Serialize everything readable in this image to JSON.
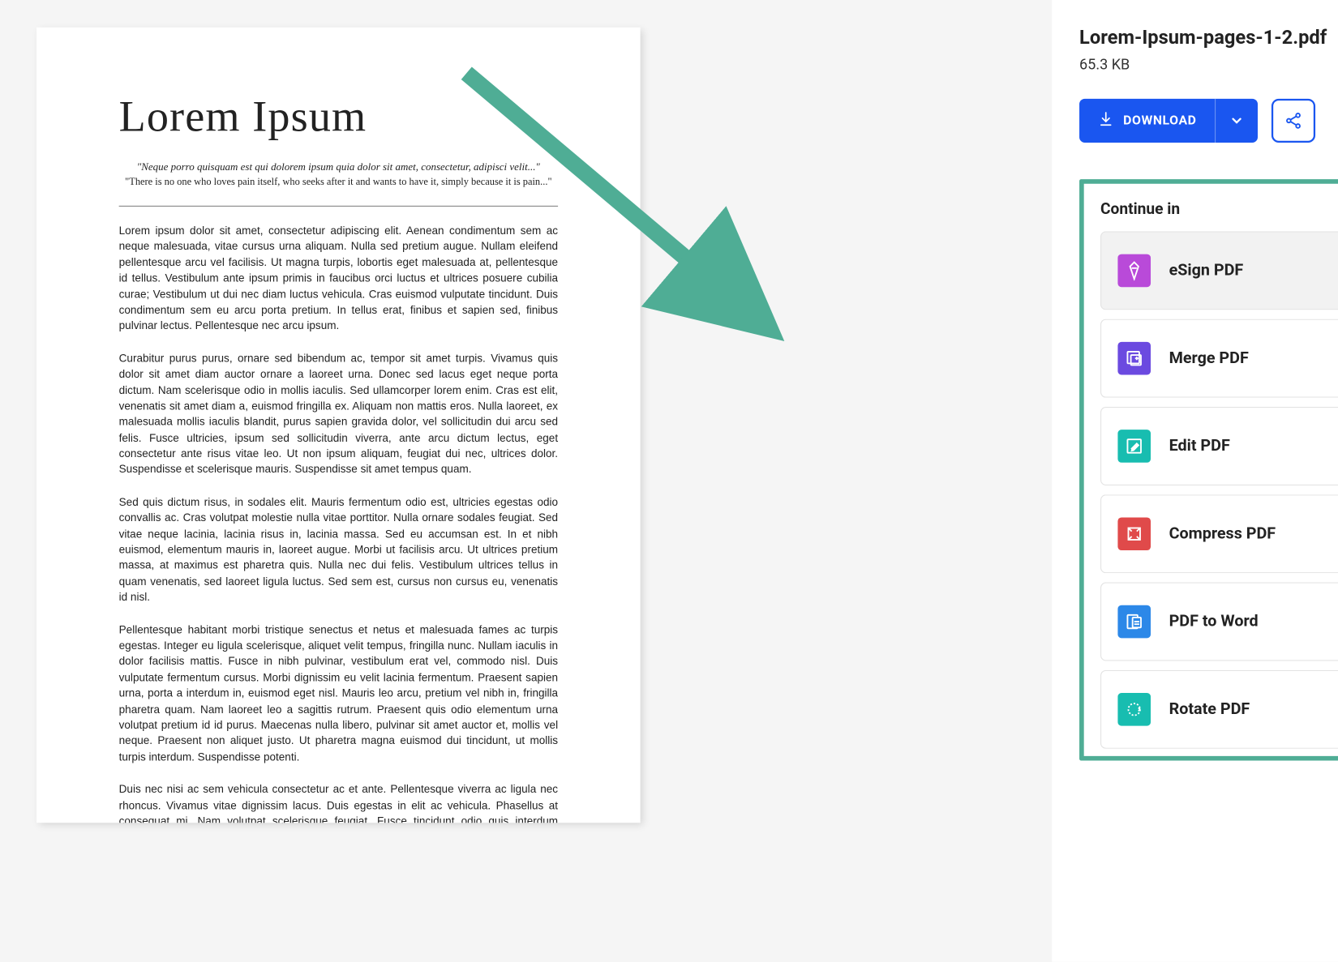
{
  "document": {
    "title": "Lorem Ipsum",
    "caption_italic": "\"Neque porro quisquam est qui dolorem ipsum quia dolor sit amet, consectetur, adipisci velit...\"",
    "caption_plain": "\"There is no one who loves pain itself, who seeks after it and wants to have it, simply because it is pain...\"",
    "paragraphs": [
      "Lorem ipsum dolor sit amet, consectetur adipiscing elit. Aenean condimentum sem ac neque malesuada, vitae cursus urna aliquam. Nulla sed pretium augue. Nullam eleifend pellentesque arcu vel facilisis. Ut magna turpis, lobortis eget malesuada at, pellentesque id tellus. Vestibulum ante ipsum primis in faucibus orci luctus et ultrices posuere cubilia curae; Vestibulum ut dui nec diam luctus vehicula. Cras euismod vulputate tincidunt. Duis condimentum sem eu arcu porta pretium. In tellus erat, finibus et sapien sed, finibus pulvinar lectus. Pellentesque nec arcu ipsum.",
      "Curabitur purus purus, ornare sed bibendum ac, tempor sit amet turpis. Vivamus quis dolor sit amet diam auctor ornare a laoreet urna. Donec sed lacus eget neque porta dictum. Nam scelerisque odio in mollis iaculis. Sed ullamcorper lorem enim. Cras est elit, venenatis sit amet diam a, euismod fringilla ex. Aliquam non mattis eros. Nulla laoreet, ex malesuada mollis iaculis blandit, purus sapien gravida dolor, vel sollicitudin dui arcu sed felis. Fusce ultricies, ipsum sed sollicitudin viverra, ante arcu dictum lectus, eget consectetur ante risus vitae leo. Ut non ipsum aliquam, feugiat dui nec, ultrices dolor. Suspendisse et scelerisque mauris. Suspendisse sit amet tempus quam.",
      "Sed quis dictum risus, in sodales elit. Mauris fermentum odio est, ultricies egestas odio convallis ac. Cras volutpat molestie nulla vitae porttitor. Nulla ornare sodales feugiat. Sed vitae neque lacinia, lacinia risus in, lacinia massa. Sed eu accumsan est. In et nibh euismod, elementum mauris in, laoreet augue. Morbi ut facilisis arcu. Ut ultrices pretium massa, at maximus est pharetra quis. Nulla nec dui felis. Vestibulum ultrices tellus in quam venenatis, sed laoreet ligula luctus. Sed sem est, cursus non cursus eu, venenatis id nisl.",
      "Pellentesque habitant morbi tristique senectus et netus et malesuada fames ac turpis egestas. Integer eu ligula scelerisque, aliquet velit tempus, fringilla nunc. Nullam iaculis in dolor facilisis mattis. Fusce in nibh pulvinar, vestibulum erat vel, commodo nisl. Duis vulputate fermentum cursus. Morbi dignissim eu velit lacinia fermentum. Praesent sapien urna, porta a interdum in, euismod eget nisl. Mauris leo arcu, pretium vel nibh in, fringilla pharetra quam. Nam laoreet leo a sagittis rutrum. Praesent quis odio elementum urna volutpat pretium id id purus. Maecenas nulla libero, pulvinar sit amet auctor et, mollis vel neque. Praesent non aliquet justo. Ut pharetra magna euismod dui tincidunt, ut mollis turpis interdum. Suspendisse potenti.",
      "Duis nec nisi ac sem vehicula consectetur ac et ante. Pellentesque viverra ac ligula nec rhoncus. Vivamus vitae dignissim lacus. Duis egestas in elit ac vehicula. Phasellus at consequat mi. Nam volutpat scelerisque feugiat. Fusce tincidunt odio quis interdum pulvinar. Nullam ornare felis sit amet nisi sodales fringilla. Integer sapien neque, imperdiet vel ligula in, consectetur semper mi. Nunc sit amet neque tempus aliquet ac sed augue. Cras ut sapien ex."
    ]
  },
  "sidebar": {
    "filename": "Lorem-Ipsum-pages-1-2.pdf",
    "filesize": "65.3 KB",
    "download_label": "DOWNLOAD",
    "continue_title": "Continue in",
    "tools": [
      {
        "icon": "pen-icon",
        "label": "eSign PDF",
        "color": "bg-purple"
      },
      {
        "icon": "merge-icon",
        "label": "Merge PDF",
        "color": "bg-violet"
      },
      {
        "icon": "edit-icon",
        "label": "Edit PDF",
        "color": "bg-teal"
      },
      {
        "icon": "compress-icon",
        "label": "Compress PDF",
        "color": "bg-red"
      },
      {
        "icon": "word-icon",
        "label": "PDF to Word",
        "color": "bg-blue"
      },
      {
        "icon": "rotate-icon",
        "label": "Rotate PDF",
        "color": "bg-teal2"
      }
    ]
  }
}
